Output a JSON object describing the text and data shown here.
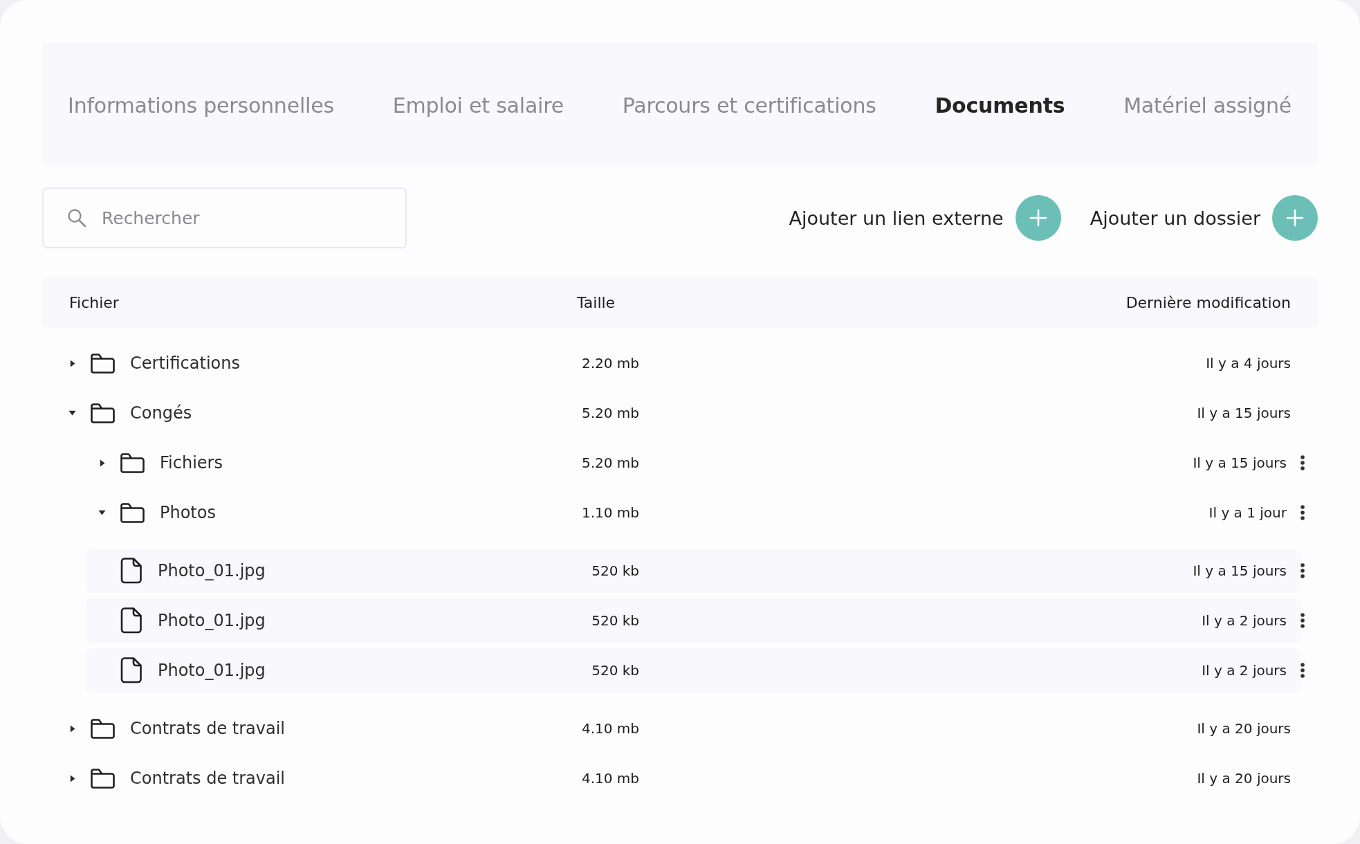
{
  "tabs": [
    {
      "label": "Informations personnelles",
      "selected": false
    },
    {
      "label": "Emploi et salaire",
      "selected": false
    },
    {
      "label": "Parcours et certifications",
      "selected": false
    },
    {
      "label": "Documents",
      "selected": true
    },
    {
      "label": "Matériel assigné",
      "selected": false
    }
  ],
  "search": {
    "placeholder": "Rechercher"
  },
  "actions": [
    {
      "label": "Ajouter un lien externe"
    },
    {
      "label": "Ajouter un dossier"
    }
  ],
  "table": {
    "columns": [
      "Fichier",
      "Taille",
      "Dernière modification"
    ],
    "rows": [
      {
        "kind": "folder",
        "name": "Certifications",
        "size": "2.20 mb",
        "modified": "Il y a 4 jours",
        "expanded": false,
        "menu": false
      },
      {
        "kind": "folder",
        "name": "Congés",
        "size": "5.20 mb",
        "modified": "Il y a 15 jours",
        "expanded": true,
        "menu": false,
        "children": [
          {
            "kind": "folder",
            "name": "Fichiers",
            "size": "5.20 mb",
            "modified": "Il y a 15 jours",
            "expanded": false,
            "menu": true
          },
          {
            "kind": "folder",
            "name": "Photos",
            "size": "1.10 mb",
            "modified": "Il y a 1 jour",
            "expanded": true,
            "menu": true,
            "children": [
              {
                "kind": "file",
                "name": "Photo_01.jpg",
                "size": "520 kb",
                "modified": "Il y a 15 jours",
                "menu": true
              },
              {
                "kind": "file",
                "name": "Photo_01.jpg",
                "size": "520 kb",
                "modified": "Il y a 2 jours",
                "menu": true
              },
              {
                "kind": "file",
                "name": "Photo_01.jpg",
                "size": "520 kb",
                "modified": "Il y a 2 jours",
                "menu": true
              }
            ]
          }
        ]
      },
      {
        "kind": "folder",
        "name": "Contrats de travail",
        "size": "4.10 mb",
        "modified": "Il y a 20 jours",
        "expanded": false,
        "menu": false
      },
      {
        "kind": "folder",
        "name": "Contrats de travail",
        "size": "4.10 mb",
        "modified": "Il y a 20 jours",
        "expanded": false,
        "menu": false
      }
    ]
  }
}
